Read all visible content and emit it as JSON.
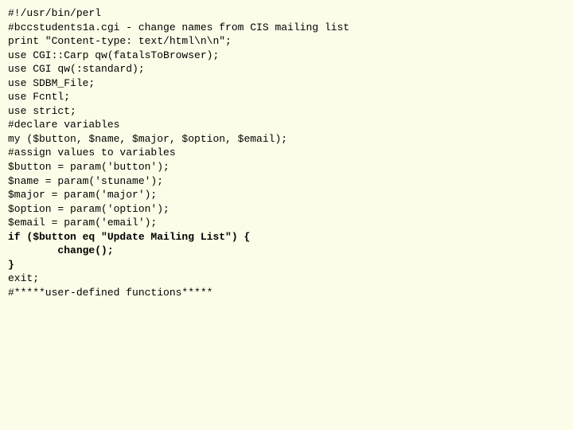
{
  "lines": [
    {
      "text": "#!/usr/bin/perl",
      "bold": false
    },
    {
      "text": "#bccstudents1a.cgi - change names from CIS mailing list",
      "bold": false
    },
    {
      "text": "print \"Content-type: text/html\\n\\n\";",
      "bold": false
    },
    {
      "text": "use CGI::Carp qw(fatalsToBrowser);",
      "bold": false
    },
    {
      "text": "use CGI qw(:standard);",
      "bold": false
    },
    {
      "text": "use SDBM_File;",
      "bold": false
    },
    {
      "text": "use Fcntl;",
      "bold": false
    },
    {
      "text": "use strict;",
      "bold": false
    },
    {
      "text": "#declare variables",
      "bold": false
    },
    {
      "text": "my ($button, $name, $major, $option, $email);",
      "bold": false
    },
    {
      "text": "#assign values to variables",
      "bold": false
    },
    {
      "text": "$button = param('button');",
      "bold": false
    },
    {
      "text": "$name = param('stuname');",
      "bold": false
    },
    {
      "text": "$major = param('major');",
      "bold": false
    },
    {
      "text": "$option = param('option');",
      "bold": false
    },
    {
      "text": "$email = param('email');",
      "bold": false
    },
    {
      "text": "if ($button eq \"Update Mailing List\") {",
      "bold": true
    },
    {
      "text": "        change();",
      "bold": true
    },
    {
      "text": "}",
      "bold": true
    },
    {
      "text": "exit;",
      "bold": false
    },
    {
      "text": "#*****user-defined functions*****",
      "bold": false
    }
  ]
}
